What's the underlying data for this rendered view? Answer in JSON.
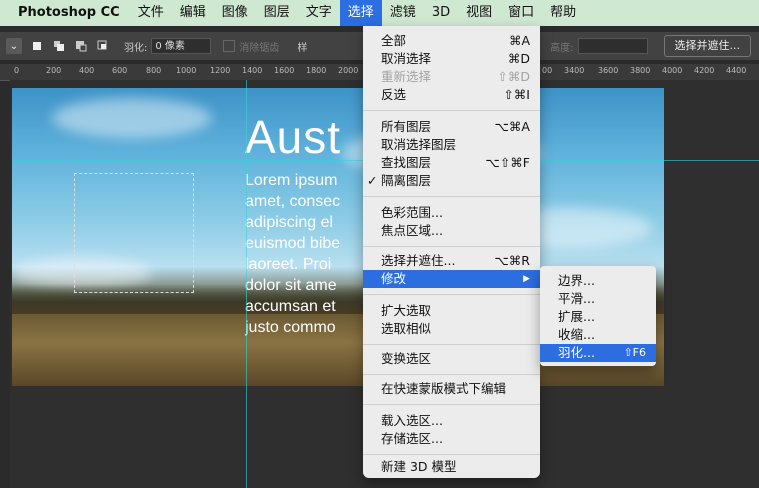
{
  "menubar": {
    "app": "Photoshop CC",
    "items": [
      "文件",
      "编辑",
      "图像",
      "图层",
      "文字",
      "选择",
      "滤镜",
      "3D",
      "视图",
      "窗口",
      "帮助"
    ],
    "active_index": 5
  },
  "options": {
    "feather_label": "羽化:",
    "feather_value": "0 像素",
    "antialias_label": "消除锯齿",
    "style_label": "样",
    "height_label": "高度:",
    "select_mask_button": "选择并遮住..."
  },
  "ruler": {
    "ticks": [
      "0",
      "200",
      "400",
      "600",
      "800",
      "1000",
      "1200",
      "1400",
      "1600",
      "1800",
      "2000",
      "00",
      "3400",
      "3600",
      "3800",
      "4000",
      "4200",
      "4400"
    ]
  },
  "document": {
    "headline": "Aust",
    "lines": [
      "Lorem ipsum",
      "amet, consec",
      "adipiscing el",
      "euismod bibe",
      "laoreet. Proi",
      "dolor sit ame",
      "accumsan et",
      "justo commo"
    ]
  },
  "select_menu": {
    "all": {
      "label": "全部",
      "shortcut": "⌘A"
    },
    "deselect": {
      "label": "取消选择",
      "shortcut": "⌘D"
    },
    "reselect": {
      "label": "重新选择",
      "shortcut": "⇧⌘D"
    },
    "inverse": {
      "label": "反选",
      "shortcut": "⇧⌘I"
    },
    "all_layers": {
      "label": "所有图层",
      "shortcut": "⌥⌘A"
    },
    "deselect_layers": {
      "label": "取消选择图层",
      "shortcut": ""
    },
    "find_layers": {
      "label": "查找图层",
      "shortcut": "⌥⇧⌘F"
    },
    "isolate_layers": {
      "label": "隔离图层",
      "check": "✓"
    },
    "color_range": {
      "label": "色彩范围..."
    },
    "focus_area": {
      "label": "焦点区域..."
    },
    "select_and_mask": {
      "label": "选择并遮住...",
      "shortcut": "⌥⌘R"
    },
    "modify": {
      "label": "修改",
      "arrow": "▶"
    },
    "grow": {
      "label": "扩大选取"
    },
    "similar": {
      "label": "选取相似"
    },
    "transform": {
      "label": "变换选区"
    },
    "quick_mask": {
      "label": "在快速蒙版模式下编辑"
    },
    "load": {
      "label": "载入选区..."
    },
    "save": {
      "label": "存储选区..."
    },
    "new_3d": {
      "label": "新建 3D 模型"
    }
  },
  "modify_submenu": {
    "border": {
      "label": "边界..."
    },
    "smooth": {
      "label": "平滑..."
    },
    "expand": {
      "label": "扩展..."
    },
    "contract": {
      "label": "收缩..."
    },
    "feather": {
      "label": "羽化...",
      "shortcut": "⇧F6"
    }
  },
  "colors": {
    "menubar_bg": "#cfe8d2",
    "highlight": "#2c6de0"
  }
}
